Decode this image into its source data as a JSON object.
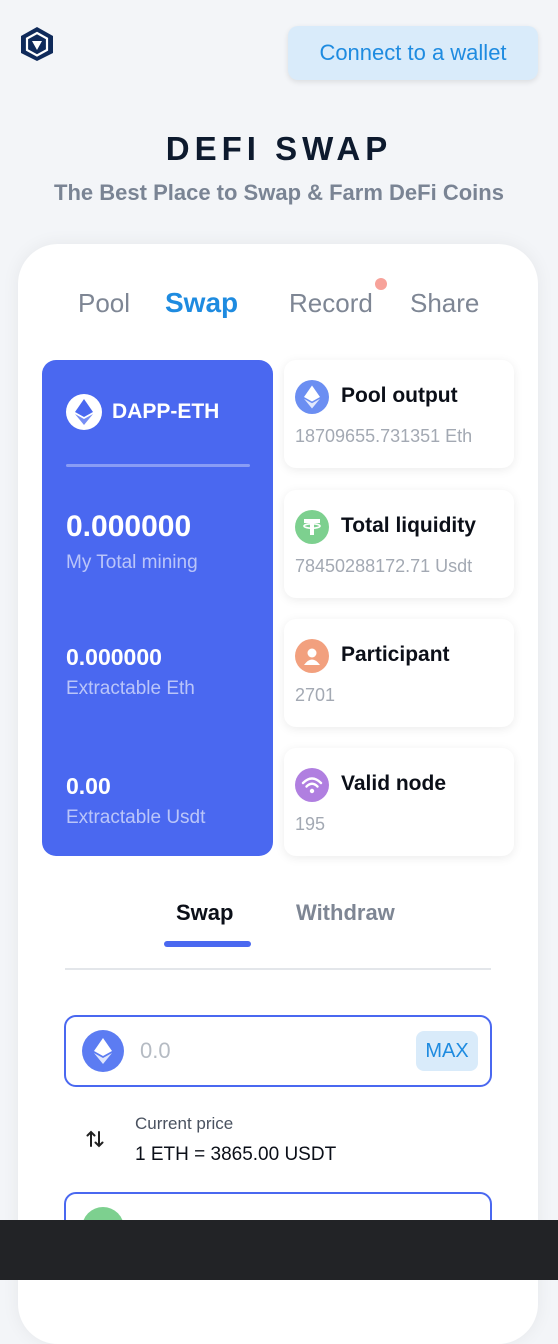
{
  "header": {
    "logo_icon": "crypto-lion-shield-logo",
    "connect_label": "Connect to a wallet"
  },
  "hero": {
    "title": "DEFI SWAP",
    "subtitle": "The Best Place to Swap & Farm DeFi Coins"
  },
  "tabs": [
    {
      "label": "Pool",
      "active": false
    },
    {
      "label": "Swap",
      "active": true
    },
    {
      "label": "Record",
      "active": false,
      "has_notification_dot": true
    },
    {
      "label": "Share",
      "active": false
    }
  ],
  "mining_panel": {
    "pair": "DAPP-ETH",
    "pair_icon": "ethereum-icon",
    "total_mining_value": "0.000000",
    "total_mining_label": "My Total mining",
    "extractable_eth_value": "0.000000",
    "extractable_eth_label": "Extractable Eth",
    "extractable_usdt_value": "0.00",
    "extractable_usdt_label": "Extractable Usdt"
  },
  "stats": [
    {
      "title": "Pool output",
      "value": "18709655.731351 Eth",
      "icon": "ethereum-icon",
      "color": "#6b8ef2"
    },
    {
      "title": "Total liquidity",
      "value": "78450288172.71 Usdt",
      "icon": "tether-icon",
      "color": "#7dd08f"
    },
    {
      "title": "Participant",
      "value": "2701",
      "icon": "user-icon",
      "color": "#f2a07e"
    },
    {
      "title": "Valid node",
      "value": "195",
      "icon": "wifi-icon",
      "color": "#b07fe0"
    }
  ],
  "swap_tabs": {
    "swap_label": "Swap",
    "withdraw_label": "Withdraw"
  },
  "from_input": {
    "token_icon": "ethereum-icon",
    "placeholder": "0.0",
    "max_label": "MAX"
  },
  "price": {
    "label": "Current price",
    "value": "1 ETH = 3865.00 USDT"
  },
  "colors": {
    "accent": "#1e8be0",
    "panel_blue": "#4a68f0",
    "background": "#f3f5f8"
  }
}
